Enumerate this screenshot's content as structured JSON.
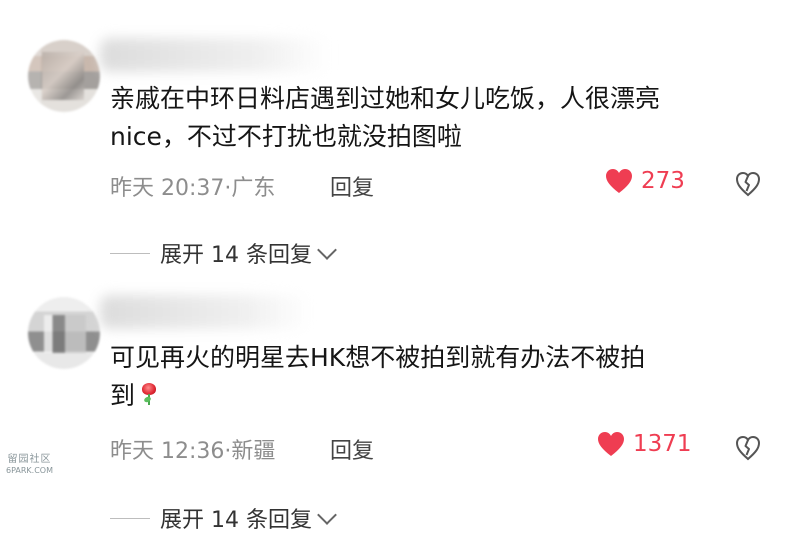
{
  "comments": [
    {
      "text_line_1": "亲戚在中环日料店遇到过她和女儿吃饭，人很漂亮",
      "text_line_2": "nice，不过不打扰也就没拍图啦",
      "time": "昨天 20:37·广东",
      "reply_label": "回复",
      "like_count": "273",
      "expand_label": "展开 14 条回复"
    },
    {
      "text_line_1": "可见再火的明星去HK想不被拍到就有办法不被拍",
      "text_line_2": "到",
      "time": "昨天 12:36·新疆",
      "reply_label": "回复",
      "like_count": "1371",
      "expand_label": "展开 14 条回复"
    }
  ],
  "icons": {
    "heart": "heart-icon",
    "broken_heart": "broken-heart-icon",
    "rose": "rose-icon",
    "chevron_down": "chevron-down-icon"
  },
  "colors": {
    "accent_red": "#ef3d52",
    "meta_gray": "#8d8d8d",
    "text_dark": "#151515"
  },
  "watermark": {
    "line_1": "留园社区",
    "line_2": "6PARK.COM"
  }
}
